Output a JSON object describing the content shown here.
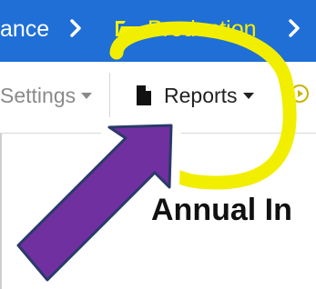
{
  "breadcrumb": {
    "previous_label": "ance",
    "current_label": "Production",
    "separator_icon": "chevron-right-icon",
    "folder_icon": "folder-open-icon",
    "bar_color": "#1f6fd6",
    "current_color": "#f6f200"
  },
  "toolbar": {
    "settings_label": "Settings",
    "reports_label": "Reports",
    "reports_icon": "file-icon",
    "trailing_icon": "circle-play-icon"
  },
  "content": {
    "title": "Annual In"
  },
  "annotations": {
    "arrow_color": "#7030a0",
    "circle_color": "#f2ee00"
  }
}
